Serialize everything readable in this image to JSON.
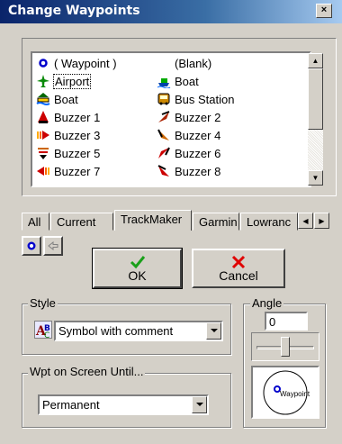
{
  "window": {
    "title": "Change Waypoints",
    "close_label": "×"
  },
  "symbols": {
    "items": [
      {
        "label": "( Waypoint )",
        "icon": "waypoint-icon"
      },
      {
        "label": "(Blank)",
        "icon": "blank-icon"
      },
      {
        "label": "Airport",
        "icon": "airport-icon"
      },
      {
        "label": "Boat",
        "icon": "boat-icon"
      },
      {
        "label": "Boat",
        "icon": "boat-ramp-icon"
      },
      {
        "label": "Bus Station",
        "icon": "bus-station-icon"
      },
      {
        "label": "Buzzer 1",
        "icon": "buzzer-1-icon"
      },
      {
        "label": "Buzzer 2",
        "icon": "buzzer-2-icon"
      },
      {
        "label": "Buzzer 3",
        "icon": "buzzer-3-icon"
      },
      {
        "label": "Buzzer 4",
        "icon": "buzzer-4-icon"
      },
      {
        "label": "Buzzer 5",
        "icon": "buzzer-5-icon"
      },
      {
        "label": "Buzzer 6",
        "icon": "buzzer-6-icon"
      },
      {
        "label": "Buzzer 7",
        "icon": "buzzer-7-icon"
      },
      {
        "label": "Buzzer 8",
        "icon": "buzzer-8-icon"
      }
    ],
    "selected": "Airport"
  },
  "tabs": [
    {
      "label": "All"
    },
    {
      "label": "Current"
    },
    {
      "label": "TrackMaker",
      "active": true
    },
    {
      "label": "Garmin"
    },
    {
      "label": "Lowranc"
    }
  ],
  "buttons": {
    "ok": "OK",
    "cancel": "Cancel"
  },
  "style": {
    "group_label": "Style",
    "value": "Symbol with comment"
  },
  "angle": {
    "group_label": "Angle",
    "value": "0",
    "slider_level": 0.5,
    "preview_label": "Waypoint"
  },
  "wpt_on_screen": {
    "group_label": "Wpt on Screen Until...",
    "value": "Permanent"
  },
  "colors": {
    "title_start": "#0a246a",
    "title_end": "#a6caf0",
    "face": "#d4d0c8",
    "ok_check": "#1aa01a",
    "cancel_x": "#e00000"
  }
}
